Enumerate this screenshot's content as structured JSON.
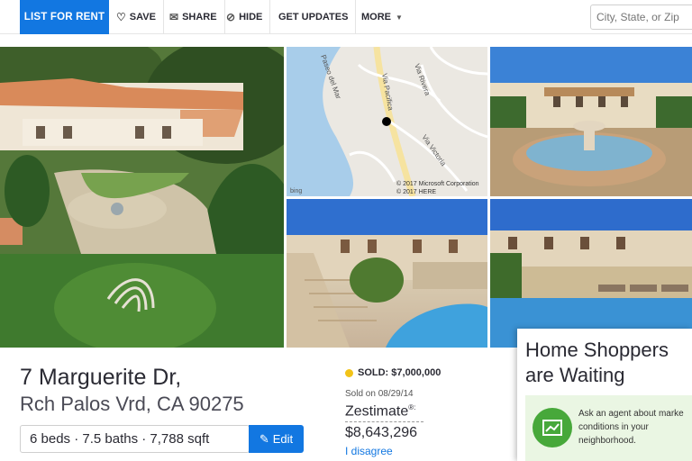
{
  "nav": {
    "list_for_rent": "LIST FOR RENT",
    "save": "SAVE",
    "share": "SHARE",
    "hide": "HIDE",
    "get_updates": "GET UPDATES",
    "more": "MORE",
    "search_placeholder": "City, State, or Zip",
    "icons": {
      "save": "heart-icon",
      "share": "mail-icon",
      "hide": "hide-circle-icon",
      "more": "caret-down-icon"
    }
  },
  "map": {
    "streets": [
      "Paseo del Mar",
      "Via Rivera",
      "Via Pacifica",
      "Via Victoria"
    ],
    "copyright_1": "© 2017 Microsoft Corporation",
    "copyright_2": "© 2017 HERE",
    "provider": "bing"
  },
  "listing": {
    "address_line1": "7 Marguerite Dr,",
    "address_line2": "Rch Palos Vrd, CA 90275",
    "stats": "6 beds · 7.5 baths · 7,788 sqft",
    "edit_label": "Edit",
    "status": "SOLD: $7,000,000",
    "sold_on": "Sold on 08/29/14",
    "zestimate_label": "Zestimate",
    "zestimate_mark": "®:",
    "zestimate_value": "$8,643,296",
    "disagree": "I disagree"
  },
  "promo": {
    "title": "Home Shoppers are Waiting",
    "text_line1": "Ask an agent about marke",
    "text_line2": "conditions in your",
    "text_line3": "neighborhood."
  },
  "colors": {
    "brand_blue": "#1277e1",
    "sold_dot": "#f2c318",
    "promo_green": "#47a83a"
  }
}
